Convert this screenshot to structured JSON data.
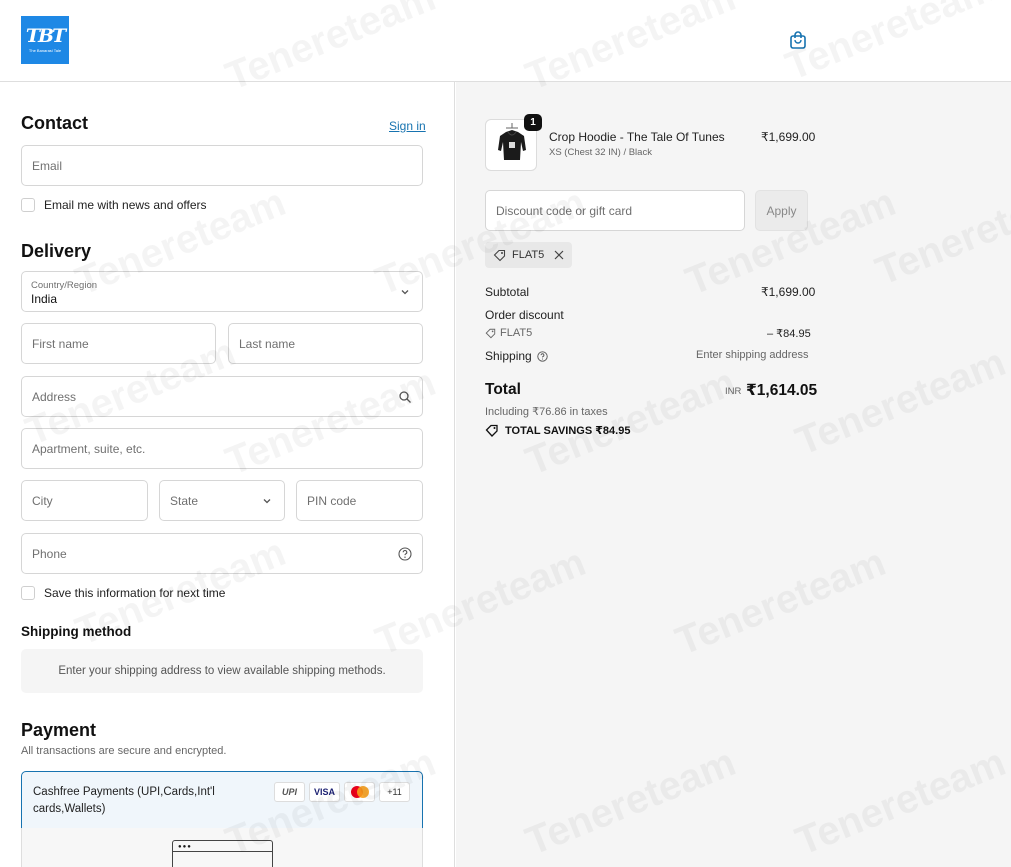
{
  "header": {
    "logo_text": "TBT",
    "logo_sub": "The Banarasi Tale",
    "bag_icon": "shopping-bag-icon"
  },
  "contact": {
    "title": "Contact",
    "sign_in": "Sign in",
    "email_placeholder": "Email",
    "news_label": "Email me with news and offers"
  },
  "delivery": {
    "title": "Delivery",
    "country_label": "Country/Region",
    "country_value": "India",
    "first_name": "First name",
    "last_name": "Last name",
    "address": "Address",
    "apartment": "Apartment, suite, etc.",
    "city": "City",
    "state": "State",
    "pin": "PIN code",
    "phone": "Phone",
    "save_label": "Save this information for next time"
  },
  "shipping": {
    "title": "Shipping method",
    "notice": "Enter your shipping address to view available shipping methods."
  },
  "payment": {
    "title": "Payment",
    "subtitle": "All transactions are secure and encrypted.",
    "method_line1": "Cashfree Payments (UPI,Cards,Int'l",
    "method_line2": "cards,Wallets)",
    "icons": [
      "UPI",
      "VISA",
      "mastercard",
      "+11"
    ]
  },
  "order": {
    "product_name": "Crop Hoodie - The Tale Of Tunes",
    "product_variant": "XS (Chest 32 IN) / Black",
    "product_price": "₹1,699.00",
    "quantity": "1",
    "discount_placeholder": "Discount code or gift card",
    "apply": "Apply",
    "code": "FLAT5",
    "subtotal_label": "Subtotal",
    "subtotal_value": "₹1,699.00",
    "order_discount_label": "Order discount",
    "discount_code": "FLAT5",
    "discount_value": "– ₹84.95",
    "shipping_label": "Shipping",
    "shipping_value": "Enter shipping address",
    "total_label": "Total",
    "currency": "INR",
    "total_value": "₹1,614.05",
    "taxes": "Including ₹76.86 in taxes",
    "savings": "TOTAL SAVINGS  ₹84.95"
  },
  "watermark": "Tenereteam"
}
